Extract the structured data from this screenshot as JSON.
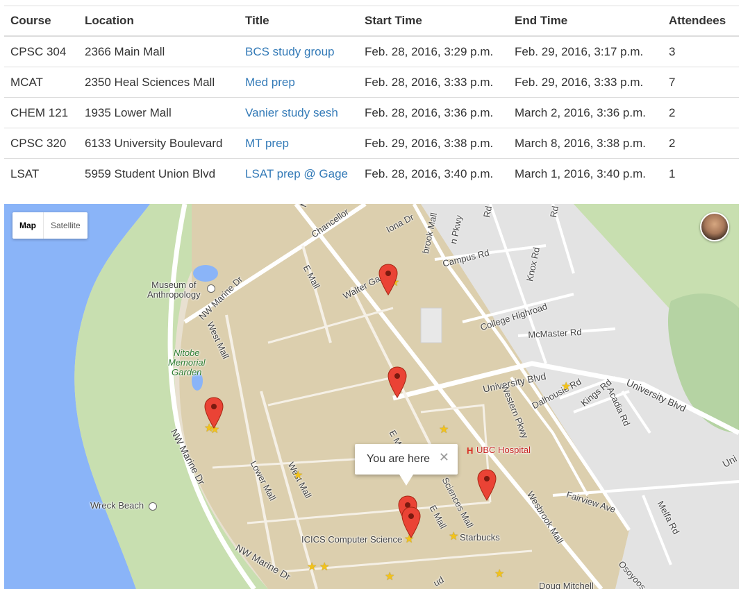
{
  "table": {
    "headers": [
      "Course",
      "Location",
      "Title",
      "Start Time",
      "End Time",
      "Attendees"
    ],
    "rows": [
      {
        "course": "CPSC 304",
        "location": "2366 Main Mall",
        "title": "BCS study group",
        "start": "Feb. 28, 2016, 3:29 p.m.",
        "end": "Feb. 29, 2016, 3:17 p.m.",
        "attendees": "3"
      },
      {
        "course": "MCAT",
        "location": "2350 Heal Sciences Mall",
        "title": "Med prep",
        "start": "Feb. 28, 2016, 3:33 p.m.",
        "end": "Feb. 29, 2016, 3:33 p.m.",
        "attendees": "7"
      },
      {
        "course": "CHEM 121",
        "location": "1935 Lower Mall",
        "title": "Vanier study sesh",
        "start": "Feb. 28, 2016, 3:36 p.m.",
        "end": "March 2, 2016, 3:36 p.m.",
        "attendees": "2"
      },
      {
        "course": "CPSC 320",
        "location": "6133 University Boulevard",
        "title": "MT prep",
        "start": "Feb. 29, 2016, 3:38 p.m.",
        "end": "March 8, 2016, 3:38 p.m.",
        "attendees": "2"
      },
      {
        "course": "LSAT",
        "location": "5959 Student Union Blvd",
        "title": "LSAT prep @ Gage",
        "start": "Feb. 28, 2016, 3:40 p.m.",
        "end": "March 1, 2016, 3:40 p.m.",
        "attendees": "1"
      }
    ]
  },
  "map": {
    "type_buttons": [
      "Map",
      "Satellite"
    ],
    "active_type": "Map",
    "info_window": {
      "text": "You are here",
      "close_glyph": "✕"
    },
    "labels": {
      "museum": "Museum of\nAnthropology",
      "nitobe": "Nitobe\nMemorial\nGarden",
      "wreck_beach": "Wreck Beach",
      "ubc_hospital": "UBC Hospital",
      "icics": "ICICS Computer Science",
      "starbucks": "Starbucks",
      "doug_mitchell": "Doug Mitchell",
      "chancellor": "Chancellor",
      "iona_dr": "Iona Dr",
      "wesbrook_mall_top": "brook Mall",
      "campus_rd": "Campus Rd",
      "knox_rd": "Knox Rd",
      "college_highroad": "College Highroad",
      "mcmaster_rd": "McMaster Rd",
      "university_blvd": "University Blvd",
      "university_blvd_east": "University Blvd",
      "dalhousie_rd": "Dalhousie Rd",
      "kings_rd": "Kings Rd",
      "acadia_rd": "Acadia Rd",
      "western_pkwy": "Western Pkwy",
      "nw_marine_dr_top": "NW Marine Dr",
      "nw_marine_dr_left": "NW Marine Dr",
      "nw_marine_dr_bottom": "NW Marine Dr",
      "west_mall": "West Mall",
      "west_mall_lower": "West Mall",
      "lower_mall": "Lower Mall",
      "e_mall_top": "E Mall",
      "e_mall_mid": "E Mall",
      "e_mall_low": "E Mall",
      "walter_gage": "Walter Gage",
      "health_sciences_mall": "Sciences Mall",
      "fairview_ave": "Fairview Ave",
      "melfa_rd": "Melfa Rd",
      "wesbrook_mall_low": "Wesbrook Mall",
      "osoyoos": "Osoyoos C",
      "pkwy": "n Pkwy",
      "rd_top": "Rd",
      "rd_top2": "Rd",
      "uni_edge": "Uni",
      "nw_top_edge": "NW",
      "ud_edge": "ud"
    },
    "colors": {
      "water": "#8ab4f8",
      "land": "#e8e0d0",
      "green": "#c8dfb0",
      "road": "#ffffff",
      "campus": "#d9ccac",
      "pin": "#ea4335",
      "link": "#337ab7"
    }
  }
}
